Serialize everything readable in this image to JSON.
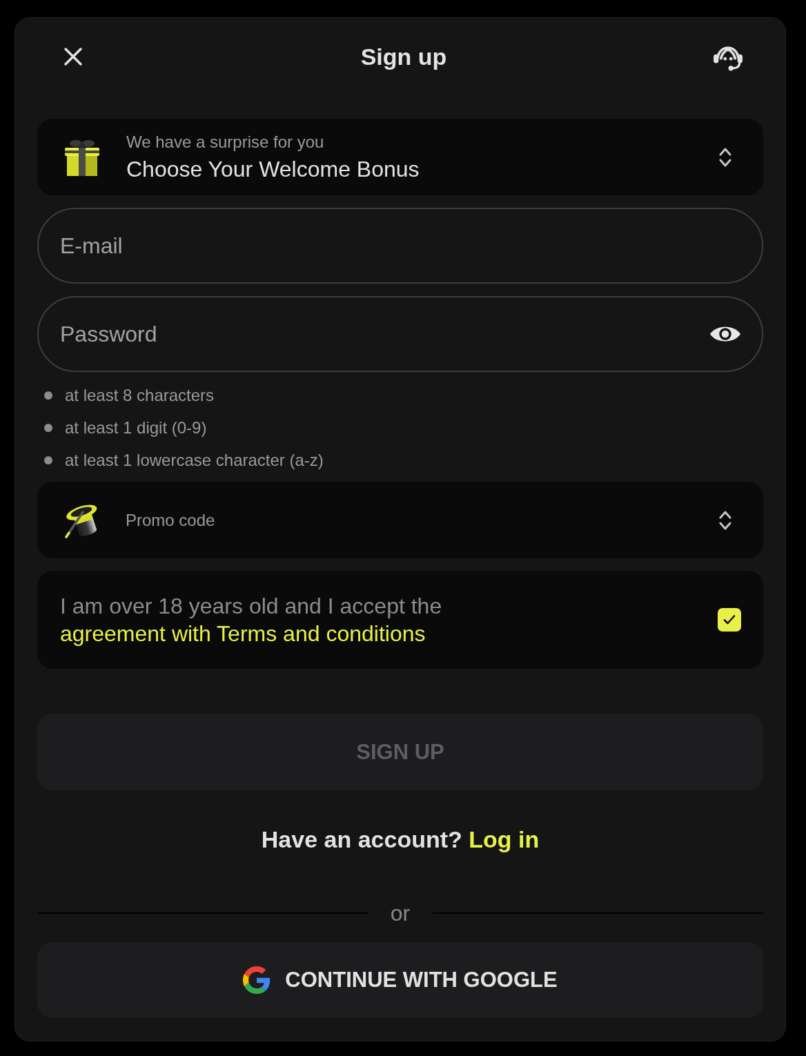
{
  "header": {
    "title": "Sign up"
  },
  "welcome_bonus": {
    "caption": "We have a surprise for you",
    "label": "Choose Your Welcome Bonus"
  },
  "fields": [
    {
      "kind": "email",
      "placeholder": "E-mail"
    },
    {
      "kind": "password",
      "placeholder": "Password"
    }
  ],
  "password_rules": [
    {
      "text": "at least 8 characters",
      "met": false
    },
    {
      "text": "at least 1 digit (0-9)",
      "met": false
    },
    {
      "text": "at least 1 lowercase character (a-z)",
      "met": false
    }
  ],
  "promo_code": {
    "label": "Promo code"
  },
  "agreement": {
    "text": "I am over 18 years old and I accept the",
    "link": "agreement with Terms and conditions",
    "checked": true
  },
  "sign_up_button": {
    "label": "SIGN UP",
    "disabled": true
  },
  "login_prompt": {
    "text": "Have an account?",
    "link": "Log in"
  },
  "divider": {
    "label": "or"
  },
  "google_button": {
    "label": "CONTINUE WITH GOOGLE"
  }
}
